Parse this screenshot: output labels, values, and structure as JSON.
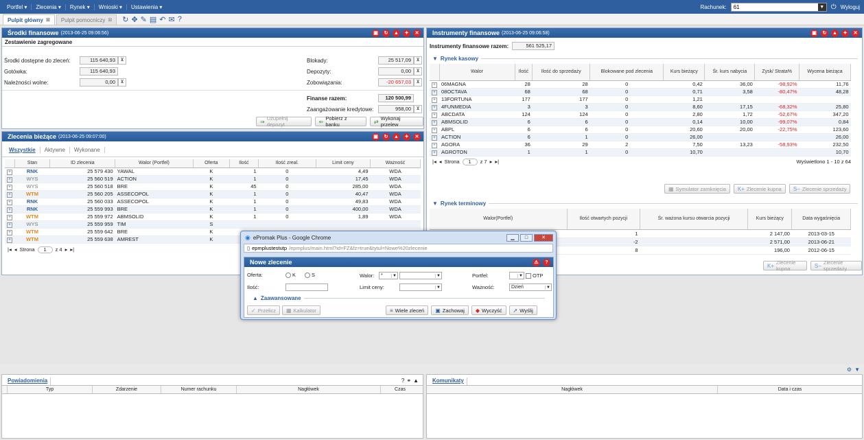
{
  "topbar": {
    "menus": [
      "Portfel ▾",
      "Zlecenia ▾",
      "Rynek ▾",
      "Wnioski ▾",
      "Ustawienia ▾"
    ],
    "account_label": "Rachunek:",
    "account_value": "61",
    "logout": "Wyloguj"
  },
  "tabs": [
    {
      "label": "Pulpit główny",
      "active": true
    },
    {
      "label": "Pulpit pomocniczy",
      "active": false
    }
  ],
  "funds": {
    "title": "Środki finansowe",
    "timestamp": "(2013-06-25 09:06:56)",
    "subtitle": "Zestawienie zagregowane",
    "left": [
      {
        "label": "Środki dostępne do zleceń:",
        "value": "115 640,93"
      },
      {
        "label": "Gotówka:",
        "value": "115 640,93"
      },
      {
        "label": "Należności wolne:",
        "value": "0,00"
      }
    ],
    "right": [
      {
        "label": "Blokady:",
        "value": "25 517,09"
      },
      {
        "label": "Depozyty:",
        "value": "0,00"
      },
      {
        "label": "Zobowiązania:",
        "value": "-20 657,03"
      }
    ],
    "total_label": "Finanse razem:",
    "total_value": "120 500,99",
    "credit_label": "Zaangażowanie kredytowe:",
    "credit_value": "958,00",
    "buttons": [
      "Uzupełnij depozyt",
      "Pobierz z banku",
      "Wykonaj przelew"
    ]
  },
  "orders": {
    "title": "Zlecenia bieżące",
    "timestamp": "(2013-06-25 09:07:00)",
    "subtabs": [
      "Wszystkie",
      "Aktywne",
      "Wykonane"
    ],
    "columns": [
      "Stan",
      "ID zlecenia",
      "Walor (Portfel)",
      "Oferta",
      "Ilość",
      "Ilość zreal.",
      "Limit ceny",
      "Ważność"
    ],
    "rows": [
      [
        "RNK",
        "25 579 430",
        "YAWAL",
        "K",
        "1",
        "0",
        "4,49",
        "WDA"
      ],
      [
        "WYS",
        "25 560 519",
        "ACTION",
        "K",
        "1",
        "0",
        "17,45",
        "WDA"
      ],
      [
        "WYS",
        "25 560 518",
        "BRE",
        "K",
        "45",
        "0",
        "285,00",
        "WDA"
      ],
      [
        "WTM",
        "25 560 205",
        "ASSECOPOL",
        "K",
        "1",
        "0",
        "40,47",
        "WDA"
      ],
      [
        "RNK",
        "25 560 033",
        "ASSECOPOL",
        "K",
        "1",
        "0",
        "49,83",
        "WDA"
      ],
      [
        "RNK",
        "25 559 993",
        "BRE",
        "K",
        "1",
        "0",
        "400,00",
        "WDA"
      ],
      [
        "WTM",
        "25 559 972",
        "ABMSOLID",
        "K",
        "1",
        "0",
        "1,89",
        "WDA"
      ],
      [
        "WYS",
        "25 559 959",
        "TIM",
        "S",
        "",
        "",
        "",
        ""
      ],
      [
        "WTM",
        "25 559 642",
        "BRE",
        "K",
        "",
        "",
        "",
        ""
      ],
      [
        "WTM",
        "25 559 638",
        "AMREST",
        "K",
        "",
        "",
        "",
        ""
      ]
    ],
    "pager": {
      "label": "Strona",
      "page": "1",
      "of": "z 4"
    }
  },
  "instruments": {
    "title": "Instrumenty finansowe",
    "timestamp": "(2013-06-25 09:06:58)",
    "total_label": "Instrumenty finansowe razem:",
    "total_value": "561 525,17",
    "cash_section": "Rynek kasowy",
    "cash_columns": [
      "Walor",
      "Ilość",
      "Ilość do sprzedaży",
      "Blokowane pod zlecenia",
      "Kurs bieżący",
      "Śr. kurs nabycia",
      "Zysk/ Strata%",
      "Wycena bieżąca"
    ],
    "cash_rows": [
      [
        "06MAGNA",
        "28",
        "28",
        "0",
        "0,42",
        "36,00",
        "-98,92%",
        "11,76"
      ],
      [
        "08OCTAVA",
        "68",
        "68",
        "0",
        "0,71",
        "3,58",
        "-80,47%",
        "48,28"
      ],
      [
        "13FORTUNA",
        "177",
        "177",
        "0",
        "1,21",
        "",
        "",
        ""
      ],
      [
        "4FUNMEDIA",
        "3",
        "3",
        "0",
        "8,60",
        "17,15",
        "-68,32%",
        "25,80"
      ],
      [
        "ABCDATA",
        "124",
        "124",
        "0",
        "2,80",
        "1,72",
        "-52,67%",
        "347,20"
      ],
      [
        "ABMSOLID",
        "6",
        "6",
        "0",
        "0,14",
        "10,00",
        "-99,07%",
        "0,84"
      ],
      [
        "ABPL",
        "6",
        "6",
        "0",
        "20,60",
        "20,00",
        "-22,75%",
        "123,60"
      ],
      [
        "ACTION",
        "6",
        "1",
        "0",
        "26,00",
        "",
        "",
        "26,00"
      ],
      [
        "AGORA",
        "36",
        "29",
        "2",
        "7,50",
        "13,23",
        "-58,93%",
        "232,50"
      ],
      [
        "AGROTON",
        "1",
        "1",
        "0",
        "10,70",
        "",
        "",
        "10,70"
      ]
    ],
    "cash_pager": {
      "label": "Strona",
      "page": "1",
      "of": "z 7",
      "shown": "Wyświetlono 1 - 10 z 64"
    },
    "cash_buttons": [
      "Symulator zamknięcia",
      "Zlecenie kupna",
      "Zlecenie sprzedaży"
    ],
    "term_section": "Rynek terminowy",
    "term_columns": [
      "Walor(Portfel)",
      "Ilość otwartych pozycji",
      "Śr. ważona kursu otwarcia pozycji",
      "Kurs bieżący",
      "Data wygaśnięcia"
    ],
    "term_rows": [
      [
        "",
        "1",
        "",
        "2 147,00",
        "2013-03-15"
      ],
      [
        "",
        "-2",
        "",
        "2 571,00",
        "2013-06-21"
      ],
      [
        "",
        "8",
        "",
        "196,00",
        "2012-06-15"
      ]
    ],
    "term_buttons": [
      "Zlecenie kupna",
      "Zlecenie sprzedaży"
    ]
  },
  "popup": {
    "window_title": "ePromak Plus - Google Chrome",
    "url_host": "epmplustestutp",
    "url_path": "/epmplus/main.html?id=FZ&fz=true&tytul=Nowe%20zlecenie",
    "form_title": "Nowe zlecenie",
    "oferta_label": "Oferta:",
    "oferta_k": "K",
    "oferta_s": "S",
    "walor_label": "Walor:",
    "walor_value": "*",
    "portfel_label": "Portfel:",
    "otp_label": "OTP",
    "ilosc_label": "Ilość:",
    "limit_label": "Limit ceny:",
    "waznosc_label": "Ważność:",
    "waznosc_value": "Dzień",
    "advanced": "Zaawansowane",
    "buttons": [
      "Przelicz",
      "Kalkulator",
      "Wiele zleceń",
      "Zachowaj",
      "Wyczyść",
      "Wyślij"
    ]
  },
  "notifications": {
    "tab": "Powiadomienia",
    "columns": [
      "Typ",
      "Zdarzenie",
      "Numer rachunku",
      "Nagłówek",
      "Czas"
    ]
  },
  "messages": {
    "tab": "Komunikaty",
    "columns": [
      "Nagłówek",
      "Data i czas"
    ]
  }
}
